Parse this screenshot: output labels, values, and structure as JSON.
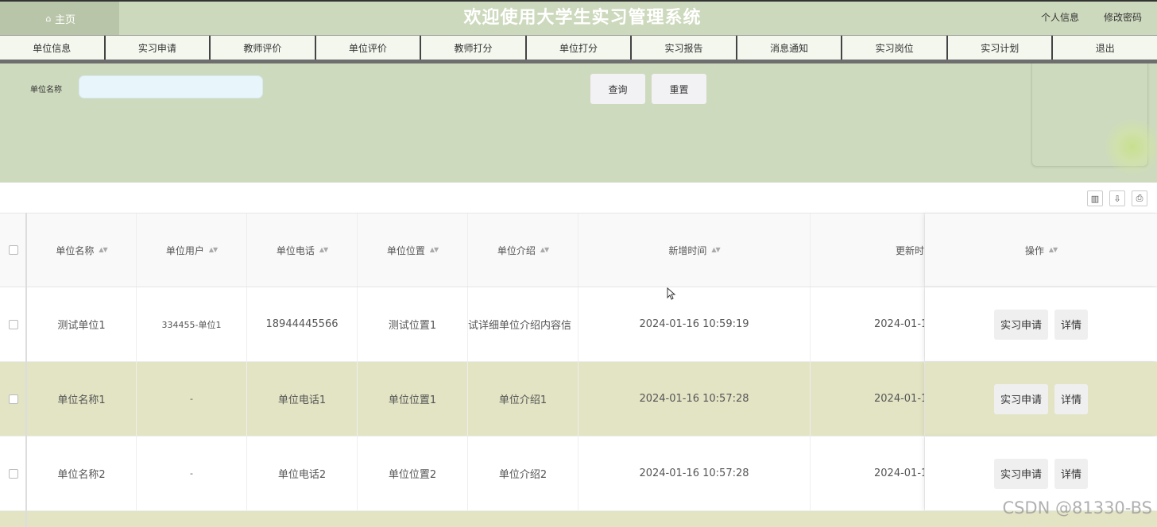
{
  "header": {
    "home_label": "主页",
    "title": "欢迎使用大学生实习管理系统",
    "profile_link": "个人信息",
    "password_link": "修改密码"
  },
  "nav": [
    "单位信息",
    "实习申请",
    "教师评价",
    "单位评价",
    "教师打分",
    "单位打分",
    "实习报告",
    "消息通知",
    "实习岗位",
    "实习计划",
    "退出"
  ],
  "search": {
    "label": "单位名称",
    "placeholder": "",
    "value": "",
    "query_button": "查询",
    "reset_button": "重置"
  },
  "toolbar": {
    "icons": [
      "columns-icon",
      "export-icon",
      "print-icon"
    ]
  },
  "table": {
    "headers": [
      "单位名称",
      "单位用户",
      "单位电话",
      "单位位置",
      "单位介绍",
      "新增时间",
      "更新时",
      "操作"
    ],
    "rows": [
      {
        "name": "测试单位1",
        "user": "334455-单位1",
        "phone": "18944445566",
        "location": "测试位置1",
        "intro": "试详细单位介绍内容信",
        "created": "2024-01-16 10:59:19",
        "updated": "2024-01-1(",
        "bg": "#ffffff"
      },
      {
        "name": "单位名称1",
        "user": "-",
        "phone": "单位电话1",
        "location": "单位位置1",
        "intro": "单位介绍1",
        "created": "2024-01-16 10:57:28",
        "updated": "2024-01-1(",
        "bg": "#e3e4c4"
      },
      {
        "name": "单位名称2",
        "user": "-",
        "phone": "单位电话2",
        "location": "单位位置2",
        "intro": "单位介绍2",
        "created": "2024-01-16 10:57:28",
        "updated": "2024-01-1(",
        "bg": "#ffffff"
      }
    ],
    "actions": {
      "apply": "实习申请",
      "detail": "详情"
    }
  },
  "watermark": "CSDN @81330-BS",
  "colors": {
    "header_bg": "#cdd9bd",
    "accent_row": "#e3e4c4",
    "search_bg": "#cedabe"
  }
}
